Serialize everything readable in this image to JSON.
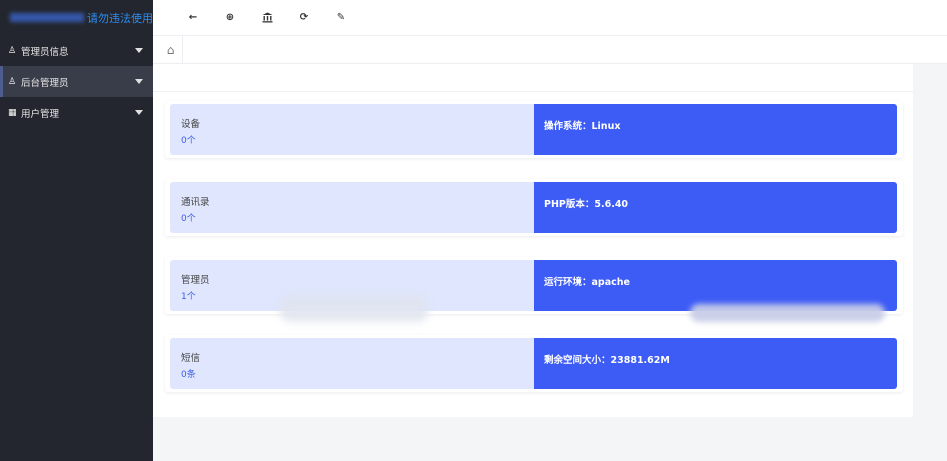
{
  "brand": {
    "suffix": "请勿违法使用"
  },
  "sidebar": {
    "items": [
      {
        "icon": "user-icon",
        "label": "管理员信息"
      },
      {
        "icon": "user-icon",
        "label": "后台管理员"
      },
      {
        "icon": "id-card-icon",
        "label": "用户管理"
      }
    ]
  },
  "toolbar": {
    "back": "←",
    "target": "⊕",
    "bank": "🏛",
    "refresh": "⟳",
    "cleanup": "✎"
  },
  "tabs": {
    "home_symbol": "⌂"
  },
  "stats": [
    {
      "title": "设备",
      "count": "0个",
      "info": "操作系统：Linux"
    },
    {
      "title": "通讯录",
      "count": "0个",
      "info": "PHP版本：5.6.40"
    },
    {
      "title": "管理员",
      "count": "1个",
      "info": "运行环境：apache"
    },
    {
      "title": "短信",
      "count": "0条",
      "info": "剩余空间大小：23881.62M"
    }
  ],
  "colors": {
    "sidebar_bg": "#23262e",
    "accent_blue": "#3d5cf5",
    "card_light": "#dfe6fd"
  }
}
